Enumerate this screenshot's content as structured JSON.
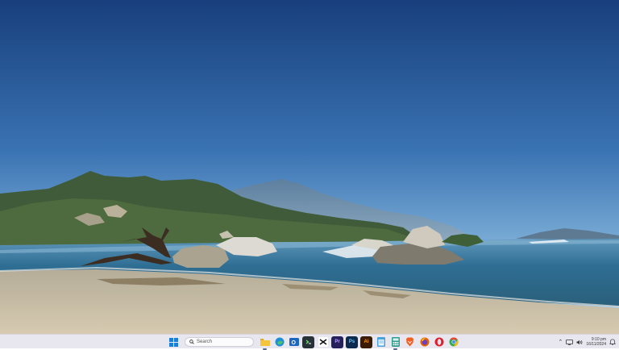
{
  "wallpaper": {
    "scene": "beach-mountains",
    "sky_top": "#1c4583",
    "sky_horizon": "#a9cbe2",
    "sea": "#2f6e93",
    "sand": "#c9bfa9"
  },
  "taskbar": {
    "background": "#e8e6ee",
    "search_label": "Search",
    "pinned_apps": [
      {
        "name": "file-explorer",
        "color": "#f3c43c"
      },
      {
        "name": "edge",
        "color": "#1f8fd6"
      },
      {
        "name": "outlook",
        "color": "#1a66c1"
      },
      {
        "name": "terminal",
        "color": "#263238"
      },
      {
        "name": "capcut",
        "color": "#111111"
      },
      {
        "name": "premiere-pro",
        "color": "#26215c"
      },
      {
        "name": "photoshop",
        "color": "#0c2a4f"
      },
      {
        "name": "illustrator",
        "color": "#3a1a00"
      },
      {
        "name": "notepad",
        "color": "#4ba3d9"
      },
      {
        "name": "calculator",
        "color": "#2d9d8f"
      },
      {
        "name": "brave",
        "color": "#f06025"
      },
      {
        "name": "firefox",
        "color": "#e66000"
      },
      {
        "name": "opera",
        "color": "#e01e2c"
      },
      {
        "name": "chrome",
        "color": "#34a853"
      }
    ],
    "tray": {
      "time": "9:10 pm",
      "date": "16/11/2024"
    }
  }
}
